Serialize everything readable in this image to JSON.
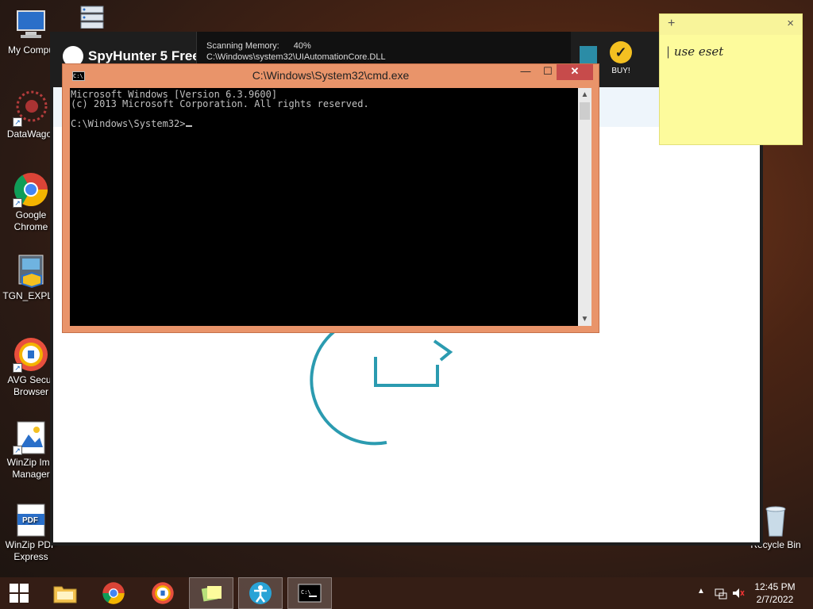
{
  "desktop": {
    "icons": [
      {
        "label": "My Compu"
      },
      {
        "label": "DataWagor"
      },
      {
        "label": "Google Chrome"
      },
      {
        "label": "TGN_EXPLC"
      },
      {
        "label": "AVG Secur Browser"
      },
      {
        "label": "WinZip Ima Manager"
      },
      {
        "label": "WinZip PDF Express"
      },
      {
        "label": "Recycle Bin"
      }
    ]
  },
  "spyhunter": {
    "logo": "SpyHunter 5 Free",
    "scan_label": "Scanning Memory:",
    "scan_percent": "40%",
    "scan_file": "C:\\Windows\\system32\\UIAutomationCore.DLL",
    "buy_label": "BUY!"
  },
  "cmd": {
    "title": "C:\\Windows\\System32\\cmd.exe",
    "icon_text": "C:\\",
    "line1": "Microsoft Windows [Version 6.3.9600]",
    "line2": "(c) 2013 Microsoft Corporation. All rights reserved.",
    "prompt": "C:\\Windows\\System32>"
  },
  "sticky": {
    "add": "+",
    "close": "×",
    "text": "use eset"
  },
  "taskbar": {
    "clock_time": "12:45 PM",
    "clock_date": "2/7/2022"
  },
  "colors": {
    "cmd_frame": "#e9946a",
    "sticky": "#fdfb9c",
    "spy_accent": "#2b8ca6"
  }
}
